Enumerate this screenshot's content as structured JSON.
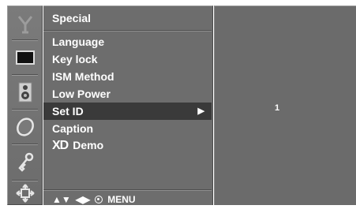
{
  "menu": {
    "title": "Special",
    "items": [
      {
        "label": "Language"
      },
      {
        "label": "Key lock"
      },
      {
        "label": "ISM Method"
      },
      {
        "label": "Low Power"
      },
      {
        "label": "Set ID",
        "selected": true,
        "arrow": "▶"
      },
      {
        "label": "Caption"
      },
      {
        "label": "Demo",
        "prefix": "XD"
      }
    ]
  },
  "nav": {
    "up_down": "▲▼",
    "left_right": "◀▶",
    "menu_label": "MENU"
  },
  "value_panel": {
    "value": "1"
  },
  "icons": [
    "tools-icon",
    "screen-icon",
    "speaker-icon",
    "clock-icon",
    "key-icon",
    "settings-icon"
  ]
}
